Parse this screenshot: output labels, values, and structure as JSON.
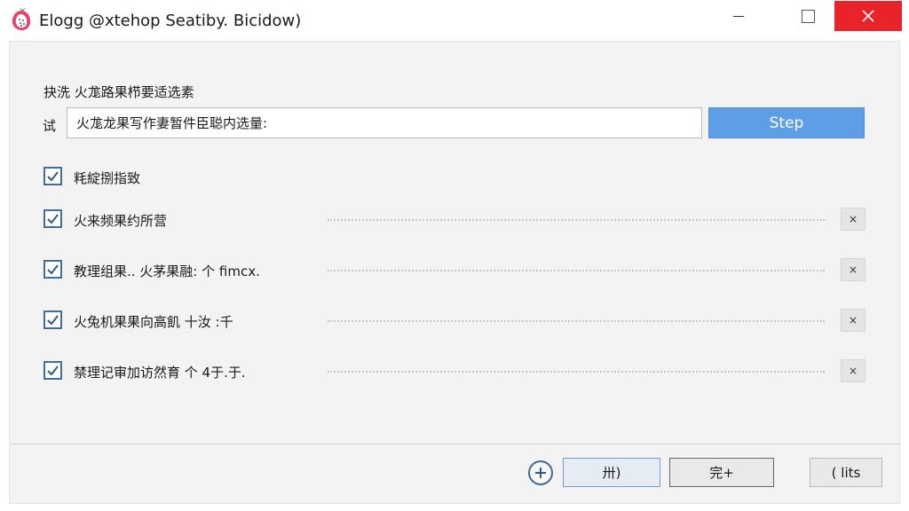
{
  "window": {
    "title": "Elogg @xtehop Seatiby. Bicidow)"
  },
  "form": {
    "heading": "抉洗 火尨路果栉要适选素",
    "path_label": "试",
    "path_value": "火尨龙果写作妻暂件臣聪内选量:",
    "step_label": "Step"
  },
  "options": [
    {
      "label": "粍綻捌指致",
      "checked": true,
      "removable": false
    },
    {
      "label": "火来频果约所营",
      "checked": true,
      "removable": true
    },
    {
      "label": "教理组果.. 火茅果融: 个 fimcx.",
      "checked": true,
      "removable": true
    },
    {
      "label": "火兔机果果向高飢 十汝 :千",
      "checked": true,
      "removable": true
    },
    {
      "label": "禁理记审加访然育 个 4于.于.",
      "checked": true,
      "removable": true
    }
  ],
  "remove_label": "×",
  "footer": {
    "btn_a": "卅)",
    "btn_b": "完+",
    "btn_c": "( lits"
  },
  "colors": {
    "accent": "#5e9ee6",
    "close": "#e8242a",
    "checkbox": "#3f6e9e"
  }
}
